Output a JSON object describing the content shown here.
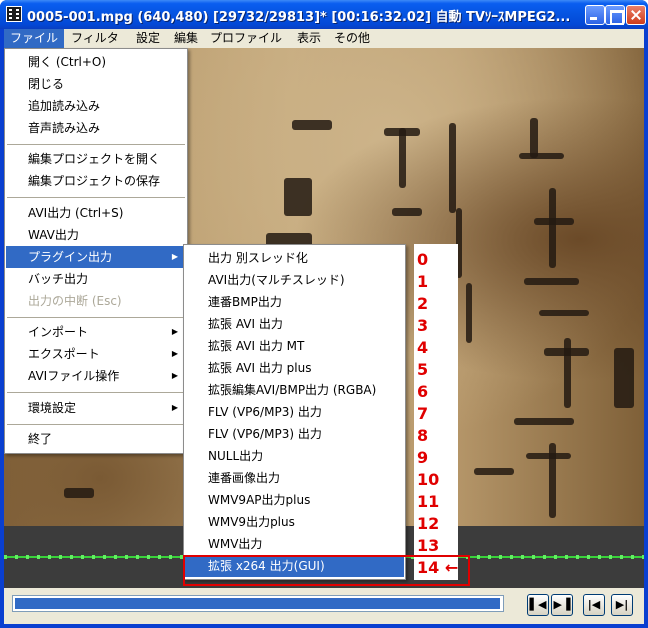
{
  "window": {
    "title": "0005-001.mpg (640,480)  [29732/29813]* [00:16:32.02]  自動  TVｿｰｽMPEG2...",
    "controls": [
      "minimize",
      "maximize",
      "close"
    ]
  },
  "menubar": [
    "ファイル",
    "フィルタ",
    "設定",
    "編集",
    "プロファイル",
    "表示",
    "その他"
  ],
  "file_menu": [
    {
      "label": "開く (Ctrl+O)"
    },
    {
      "label": "閉じる"
    },
    {
      "label": "追加読み込み"
    },
    {
      "label": "音声読み込み"
    },
    {
      "separator": true
    },
    {
      "label": "編集プロジェクトを開く"
    },
    {
      "label": "編集プロジェクトの保存"
    },
    {
      "separator": true
    },
    {
      "label": "AVI出力 (Ctrl+S)"
    },
    {
      "label": "WAV出力"
    },
    {
      "label": "プラグイン出力",
      "submenu": true,
      "highlighted": true
    },
    {
      "label": "バッチ出力"
    },
    {
      "label": "出力の中断 (Esc)",
      "disabled": true
    },
    {
      "separator": true
    },
    {
      "label": "インポート",
      "submenu": true
    },
    {
      "label": "エクスポート",
      "submenu": true
    },
    {
      "label": "AVIファイル操作",
      "submenu": true
    },
    {
      "separator": true
    },
    {
      "label": "環境設定",
      "submenu": true
    },
    {
      "separator": true
    },
    {
      "label": "終了"
    }
  ],
  "plugin_submenu": [
    "出力 別スレッド化",
    "AVI出力(マルチスレッド)",
    "連番BMP出力",
    "拡張 AVI 出力",
    "拡張 AVI 出力 MT",
    "拡張 AVI 出力 plus",
    "拡張編集AVI/BMP出力 (RGBA)",
    "FLV (VP6/MP3) 出力",
    "FLV (VP6/MP3) 出力",
    "NULL出力",
    "連番画像出力",
    "WMV9AP出力plus",
    "WMV9出力plus",
    "WMV出力",
    "拡張 x264 出力(GUI)"
  ],
  "plugin_submenu_selected": 14,
  "annotation_numbers": [
    "0",
    "1",
    "2",
    "3",
    "4",
    "5",
    "6",
    "7",
    "8",
    "9",
    "10",
    "11",
    "12",
    "13",
    "14 ←"
  ],
  "seek_progress": 0.997,
  "colors": {
    "highlight": "#316ac5",
    "annotation": "#e00000",
    "timeline": "#39d23a"
  },
  "icons": [
    "app-icon",
    "submenu-arrow-icon",
    "prev-frame-icon",
    "next-frame-icon",
    "first-frame-icon",
    "last-frame-icon"
  ]
}
